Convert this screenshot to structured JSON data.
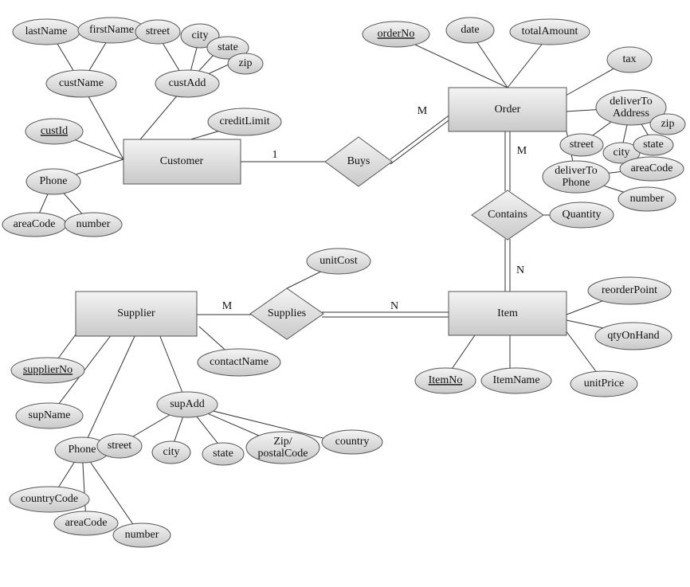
{
  "entities": {
    "customer": "Customer",
    "order": "Order",
    "supplier": "Supplier",
    "item": "Item"
  },
  "relationships": {
    "buys": "Buys",
    "contains": "Contains",
    "supplies": "Supplies"
  },
  "cardinalities": {
    "buys_customer": "1",
    "buys_order": "M",
    "contains_order": "M",
    "contains_item": "N",
    "supplies_supplier": "M",
    "supplies_item": "N"
  },
  "attrs": {
    "custId": "custId",
    "custName": "custName",
    "lastName": "lastName",
    "firstName": "firstName",
    "custAdd": "custAdd",
    "street": "street",
    "city": "city",
    "state": "state",
    "zip": "zip",
    "creditLimit": "creditLimit",
    "phone": "Phone",
    "areaCode": "areaCode",
    "number": "number",
    "orderNo": "orderNo",
    "date": "date",
    "totalAmount": "totalAmount",
    "tax": "tax",
    "deliverToAddress": "deliverTo\nAddress",
    "deliverToPhone": "deliverTo\nPhone",
    "quantity": "Quantity",
    "supplierNo": "supplierNo",
    "supName": "supName",
    "contactName": "contactName",
    "supAdd": "supAdd",
    "zipPostal": "Zip/\npostalCode",
    "country": "country",
    "countryCode": "countryCode",
    "itemNo": "ItemNo",
    "itemName": "ItemName",
    "unitPrice": "unitPrice",
    "qtyOnHand": "qtyOnHand",
    "reorderPoint": "reorderPoint",
    "unitCost": "unitCost"
  }
}
